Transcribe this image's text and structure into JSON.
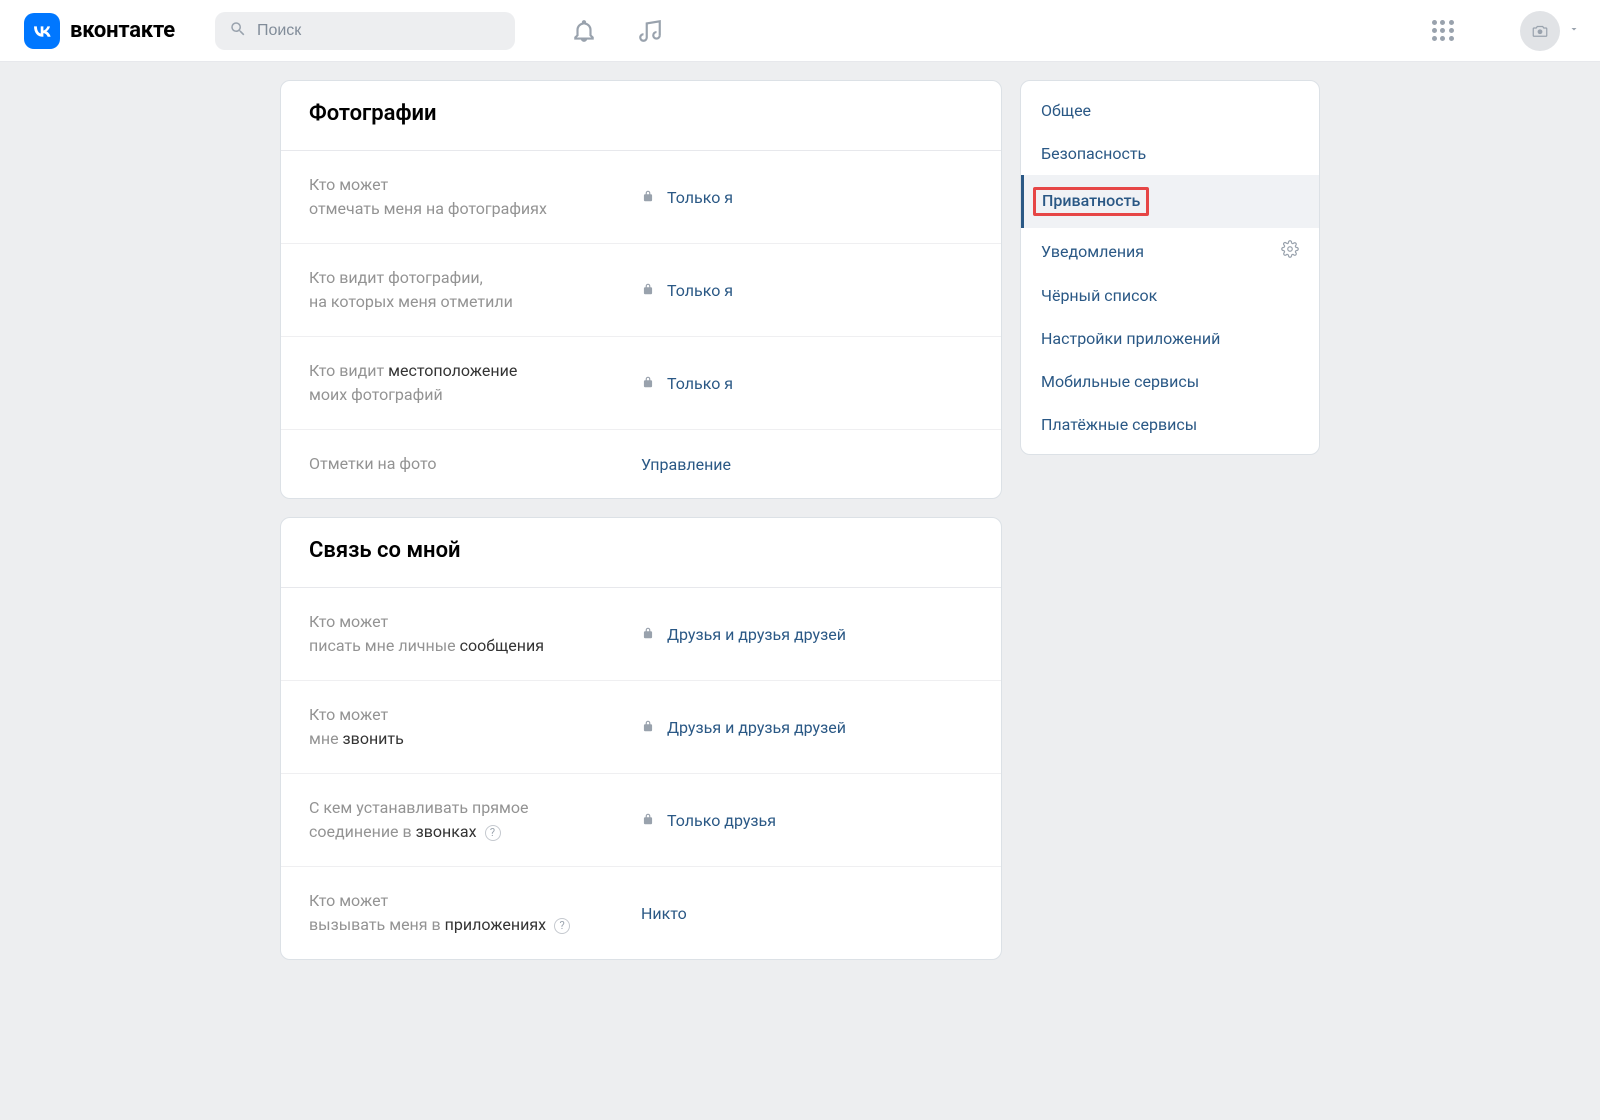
{
  "header": {
    "brand": "вконтакте",
    "search_placeholder": "Поиск"
  },
  "sidebar": {
    "items": [
      {
        "label": "Общее"
      },
      {
        "label": "Безопасность"
      },
      {
        "label": "Приватность",
        "active": true,
        "highlighted": true
      },
      {
        "label": "Уведомления",
        "has_gear": true
      },
      {
        "label": "Чёрный список"
      },
      {
        "label": "Настройки приложений"
      },
      {
        "label": "Мобильные сервисы"
      },
      {
        "label": "Платёжные сервисы"
      }
    ]
  },
  "sections": {
    "photos": {
      "title": "Фотографии",
      "rows": [
        {
          "label_pre": "Кто может",
          "label_post": "отмечать меня на фотографиях",
          "value": "Только я",
          "locked": true
        },
        {
          "label_pre": "Кто видит фотографии,",
          "label_post": "на которых меня отметили",
          "value": "Только я",
          "locked": true
        },
        {
          "label_pre": "Кто видит местоположение",
          "label_post": "моих фотографий",
          "value": "Только я",
          "locked": true,
          "partial_muted_pre": "Кто видит ",
          "partial_bold": "местоположение"
        },
        {
          "label_single": "Отметки на фото",
          "value": "Управление",
          "locked": false
        }
      ]
    },
    "contact": {
      "title": "Связь со мной",
      "rows": [
        {
          "label_pre": "Кто может",
          "label_post_pre": "писать мне личные ",
          "label_post_bold": "сообщения",
          "value": "Друзья и друзья друзей",
          "locked": true
        },
        {
          "label_pre": "Кто может",
          "label_post_pre": "мне ",
          "label_post_bold": "звонить",
          "value": "Друзья и друзья друзей",
          "locked": true
        },
        {
          "label_pre": "С кем устанавливать прямое",
          "label_post_pre": "соединение в ",
          "label_post_bold": "звонках",
          "has_help": true,
          "value": "Только друзья",
          "locked": true
        },
        {
          "label_pre": "Кто может",
          "label_post_pre": "вызывать меня в ",
          "label_post_bold": "приложениях",
          "has_help": true,
          "value": "Никто",
          "locked": false
        }
      ]
    }
  }
}
